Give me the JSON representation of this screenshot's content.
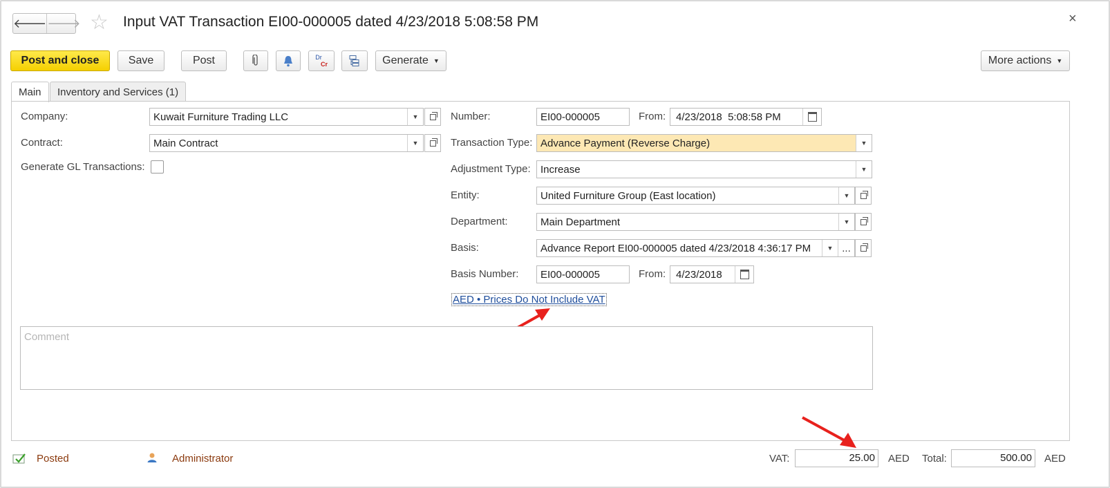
{
  "window": {
    "title": "Input VAT Transaction EI00-000005 dated 4/23/2018 5:08:58 PM",
    "close": "×"
  },
  "nav": {
    "back": "🡐",
    "forward": "🡒",
    "star": "☆"
  },
  "toolbar": {
    "post_and_close": "Post and close",
    "save": "Save",
    "post": "Post",
    "drcr_dr": "Dr",
    "drcr_cr": "Cr",
    "generate": "Generate",
    "more_actions": "More actions"
  },
  "tabs": [
    "Main",
    "Inventory and Services (1)"
  ],
  "form": {
    "company_label": "Company:",
    "company_value": "Kuwait Furniture Trading LLC",
    "contract_label": "Contract:",
    "contract_value": "Main Contract",
    "generate_gl_label": "Generate GL Transactions:",
    "number_label": "Number:",
    "number_value": "EI00-000005",
    "from_label": "From:",
    "from_value": "4/23/2018  5:08:58 PM",
    "transaction_type_label": "Transaction Type:",
    "transaction_type_value": "Advance Payment (Reverse Charge)",
    "adjustment_type_label": "Adjustment Type:",
    "adjustment_type_value": "Increase",
    "entity_label": "Entity:",
    "entity_value": "United Furniture Group (East location)",
    "department_label": "Department:",
    "department_value": "Main Department",
    "basis_label": "Basis:",
    "basis_value": "Advance Report EI00-000005 dated 4/23/2018 4:36:17 PM",
    "basis_dots": "...",
    "basis_number_label": "Basis Number:",
    "basis_number_value": "EI00-000005",
    "basis_from_label": "From:",
    "basis_from_value": "4/23/2018",
    "prices_link": "AED • Prices Do Not Include VAT",
    "comment_placeholder": "Comment"
  },
  "footer": {
    "status": "Posted",
    "user": "Administrator",
    "vat_label": "VAT:",
    "vat_value": "25.00",
    "vat_currency": "AED",
    "total_label": "Total:",
    "total_value": "500.00",
    "total_currency": "AED"
  },
  "colors": {
    "primary_button": "#f5d000",
    "highlight_field": "#fde8b4",
    "link": "#1f4e9c",
    "status_text": "#8b3a0e",
    "annotation_arrow": "#e8211d"
  }
}
